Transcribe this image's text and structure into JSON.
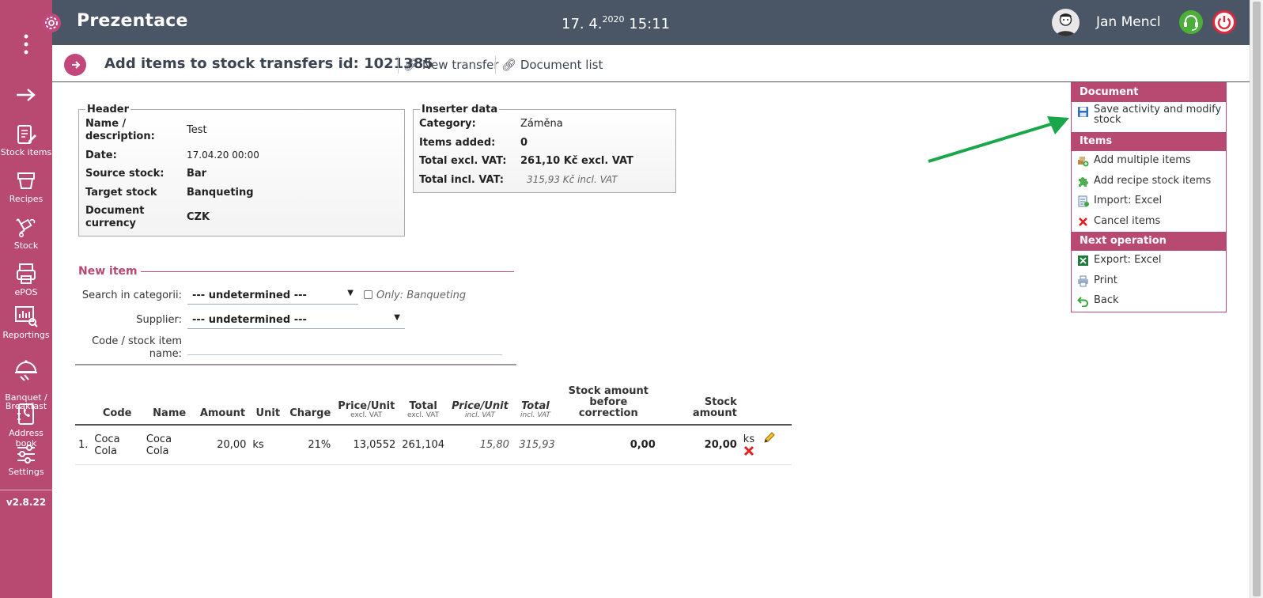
{
  "topbar": {
    "app_title": "Prezentace",
    "date": "17. 4.",
    "year": "2020",
    "time": "15:11",
    "user_name": "Jan Mencl"
  },
  "sidebar": {
    "items": [
      {
        "label": "Stock items"
      },
      {
        "label": "Recipes"
      },
      {
        "label": "Stock"
      },
      {
        "label": "ePOS"
      },
      {
        "label": "Reportings"
      },
      {
        "label": "Banquet /\nBreakfast"
      },
      {
        "label": "Address book"
      },
      {
        "label": "Settings"
      }
    ],
    "version": "v2.8.22"
  },
  "page": {
    "title": "Add items to stock transfers id: 1021385",
    "links": [
      "New transfer",
      "Document list"
    ]
  },
  "header_box": {
    "legend": "Header",
    "rows": [
      {
        "label": "Name /\ndescription:",
        "value": "Test"
      },
      {
        "label": "Date:",
        "value": "17.04.20 00:00"
      },
      {
        "label": "Source stock:",
        "value": "Bar"
      },
      {
        "label": "Target stock",
        "value": "Banqueting"
      },
      {
        "label": "Document\ncurrency",
        "value": "CZK"
      }
    ]
  },
  "inserter_box": {
    "legend": "Inserter data",
    "rows": [
      {
        "label": "Category:",
        "value": "Záměna"
      },
      {
        "label": "Items added:",
        "value": "0"
      },
      {
        "label": "Total excl. VAT:",
        "value": "261,10 Kč excl. VAT"
      },
      {
        "label": "Total incl. VAT:",
        "value": "315,93 Kč incl. VAT"
      }
    ]
  },
  "new_item": {
    "heading": "New item",
    "search_label": "Search in categorii:",
    "search_value": "--- undetermined ---",
    "only_label": "Only: Banqueting",
    "supplier_label": "Supplier:",
    "supplier_value": "--- undetermined ---",
    "code_label": "Code / stock item\nname:"
  },
  "table": {
    "headers": {
      "code": "Code",
      "name": "Name",
      "amount": "Amount",
      "unit": "Unit",
      "charge": "Charge",
      "price_excl": "Price/Unit",
      "price_excl_sub": "excl. VAT",
      "total_excl": "Total",
      "total_excl_sub": "excl. VAT",
      "price_incl": "Price/Unit",
      "price_incl_sub": "incl. VAT",
      "total_incl": "Total",
      "total_incl_sub": "incl. VAT",
      "stock_before": "Stock amount\nbefore correction",
      "stock_amount": "Stock amount"
    },
    "rows": [
      {
        "num": "1.",
        "code": "Coca Cola",
        "name": "Coca Cola",
        "amount": "20,00",
        "unit": "ks",
        "charge": "21%",
        "price_excl": "13,0552",
        "total_excl": "261,104",
        "price_incl": "15,80",
        "total_incl": "315,93",
        "stock_before": "0,00",
        "stock_amount": "20,00",
        "stock_unit": "ks"
      }
    ]
  },
  "panel": {
    "document_header": "Document",
    "save_label": "Save activity and modify stock",
    "items_header": "Items",
    "items": [
      "Add multiple items",
      "Add recipe stock items",
      "Import: Excel",
      "Cancel items"
    ],
    "next_header": "Next operation",
    "next": [
      "Export: Excel",
      "Print",
      "Back"
    ]
  },
  "colors": {
    "sidebar": "#b84a72",
    "topbar": "#4a5566",
    "accent": "#c2477a",
    "arrow": "#1aa64a"
  }
}
